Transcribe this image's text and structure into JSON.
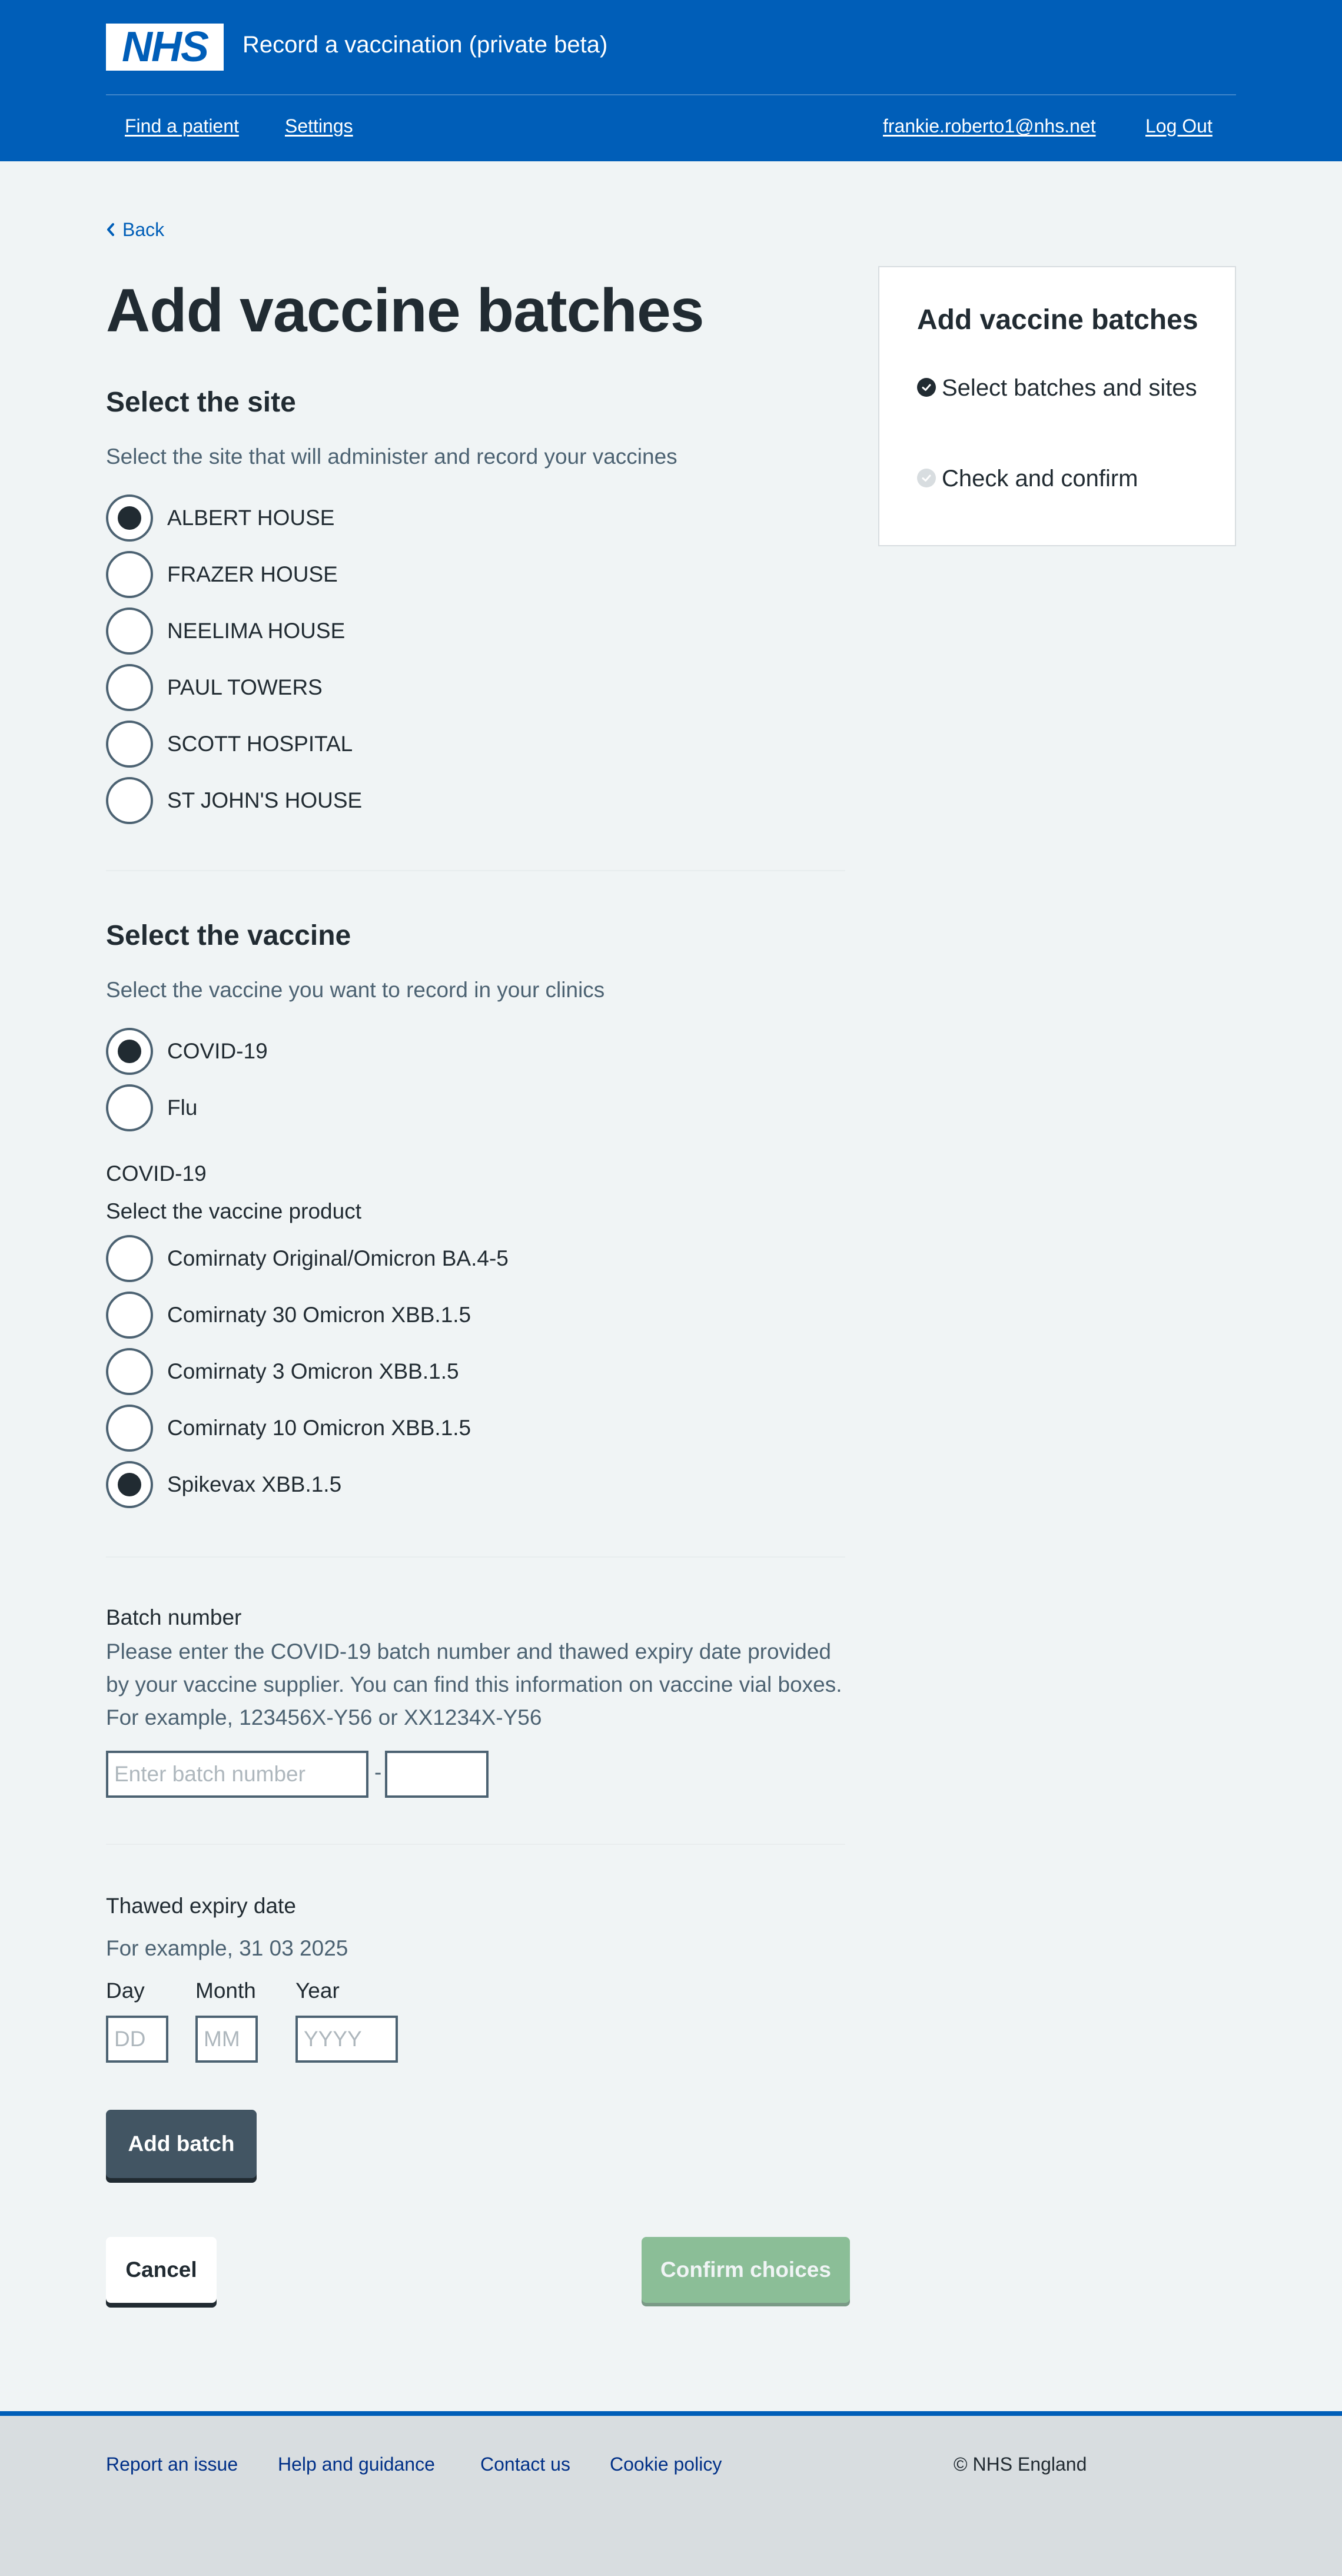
{
  "header": {
    "logo_text": "NHS",
    "service_name": "Record a vaccination (private beta)",
    "nav": {
      "find_patient": "Find a patient",
      "settings": "Settings"
    },
    "user_email": "frankie.roberto1@nhs.net",
    "logout": "Log Out"
  },
  "back_link": "Back",
  "page_title": "Add vaccine batches",
  "site": {
    "heading": "Select the site",
    "hint": "Select the site that will administer and record your vaccines",
    "options": [
      "ALBERT HOUSE",
      "FRAZER HOUSE",
      "NEELIMA HOUSE",
      "PAUL TOWERS",
      "SCOTT HOSPITAL",
      "ST JOHN'S HOUSE"
    ],
    "selected": "ALBERT HOUSE"
  },
  "vaccine": {
    "heading": "Select the vaccine",
    "hint": "Select the vaccine you want to record in your clinics",
    "options": [
      "COVID-19",
      "Flu"
    ],
    "selected": "COVID-19",
    "product_group_label": "COVID-19",
    "product_label": "Select the vaccine product",
    "products": [
      "Comirnaty Original/Omicron BA.4-5",
      "Comirnaty 30 Omicron XBB.1.5",
      "Comirnaty 3 Omicron XBB.1.5",
      "Comirnaty 10 Omicron XBB.1.5",
      "Spikevax XBB.1.5"
    ],
    "selected_product": "Spikevax XBB.1.5"
  },
  "batch": {
    "label": "Batch number",
    "hint": "Please enter the COVID-19 batch number and thawed expiry date provided by your vaccine supplier. You can find this information on vaccine vial boxes. For example, 123456X-Y56 or XX1234X-Y56",
    "placeholder": "Enter batch number",
    "separator": "-",
    "suffix_value": ""
  },
  "expiry": {
    "label": "Thawed expiry date",
    "hint": "For example, 31 03 2025",
    "day_label": "Day",
    "month_label": "Month",
    "year_label": "Year",
    "day_placeholder": "DD",
    "month_placeholder": "MM",
    "year_placeholder": "YYYY"
  },
  "buttons": {
    "add_batch": "Add batch",
    "cancel": "Cancel",
    "confirm": "Confirm choices"
  },
  "panel": {
    "title": "Add vaccine batches",
    "steps": [
      {
        "label": "Select batches and sites",
        "status": "current"
      },
      {
        "label": "Check and confirm",
        "status": "pending"
      }
    ]
  },
  "footer": {
    "links": [
      "Report an issue",
      "Help and guidance",
      "Contact us",
      "Cookie policy"
    ],
    "copyright": "© NHS England"
  },
  "colors": {
    "nhs_blue": "#005eb8",
    "background": "#f0f4f5",
    "secondary_button": "#425563",
    "confirm_disabled": "#8bbe97"
  }
}
